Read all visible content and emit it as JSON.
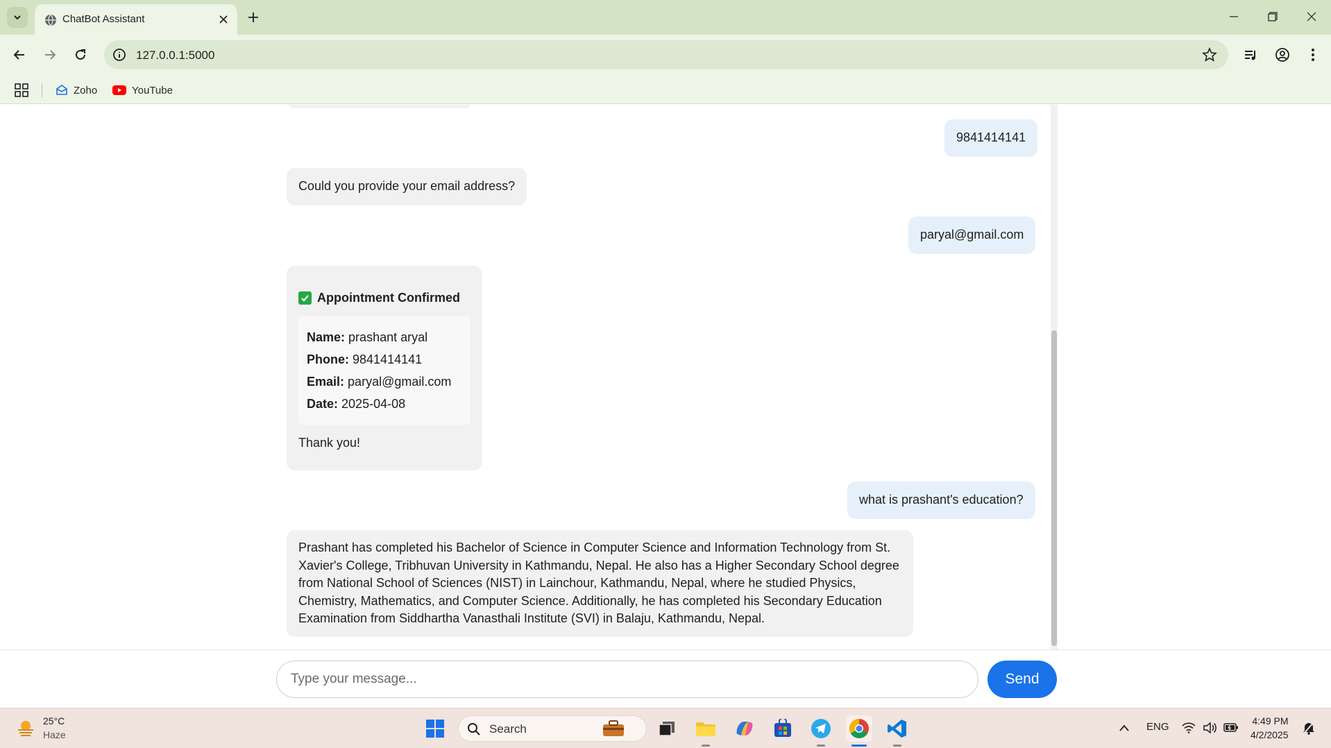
{
  "browser": {
    "tab_title": "ChatBot Assistant",
    "url": "127.0.0.1:5000",
    "bookmarks": [
      {
        "label": "Zoho",
        "icon": "zoho-icon"
      },
      {
        "label": "YouTube",
        "icon": "youtube-icon"
      }
    ]
  },
  "chat": {
    "messages": [
      {
        "role": "user",
        "text": "9841414141"
      },
      {
        "role": "bot",
        "text": "Could you provide your email address?"
      },
      {
        "role": "user",
        "text": "paryal@gmail.com"
      },
      {
        "role": "user",
        "text": "what is prashant's education?"
      },
      {
        "role": "bot",
        "text": "Prashant has completed his Bachelor of Science in Computer Science and Information Technology from St. Xavier's College, Tribhuvan University in Kathmandu, Nepal. He also has a Higher Secondary School degree from National School of Sciences (NIST) in Lainchour, Kathmandu, Nepal, where he studied Physics, Chemistry, Mathematics, and Computer Science. Additionally, he has completed his Secondary Education Examination from Siddhartha Vanasthali Institute (SVI) in Balaju, Kathmandu, Nepal."
      }
    ],
    "confirmation": {
      "title": "Appointment Confirmed",
      "name_label": "Name:",
      "name": "prashant aryal",
      "phone_label": "Phone:",
      "phone": "9841414141",
      "email_label": "Email:",
      "email": "paryal@gmail.com",
      "date_label": "Date:",
      "date": "2025-04-08",
      "thanks": "Thank you!"
    },
    "input_placeholder": "Type your message...",
    "send_label": "Send"
  },
  "taskbar": {
    "temperature": "25°C",
    "condition": "Haze",
    "search_placeholder": "Search",
    "language": "ENG",
    "time": "4:49 PM",
    "date": "4/2/2025"
  },
  "colors": {
    "accent": "#1a73e8",
    "user_bubble": "#e6f0fb",
    "bot_bubble": "#f1f1f1",
    "confirm_check": "#28a745",
    "chrome_frame": "#d3e3c4"
  }
}
